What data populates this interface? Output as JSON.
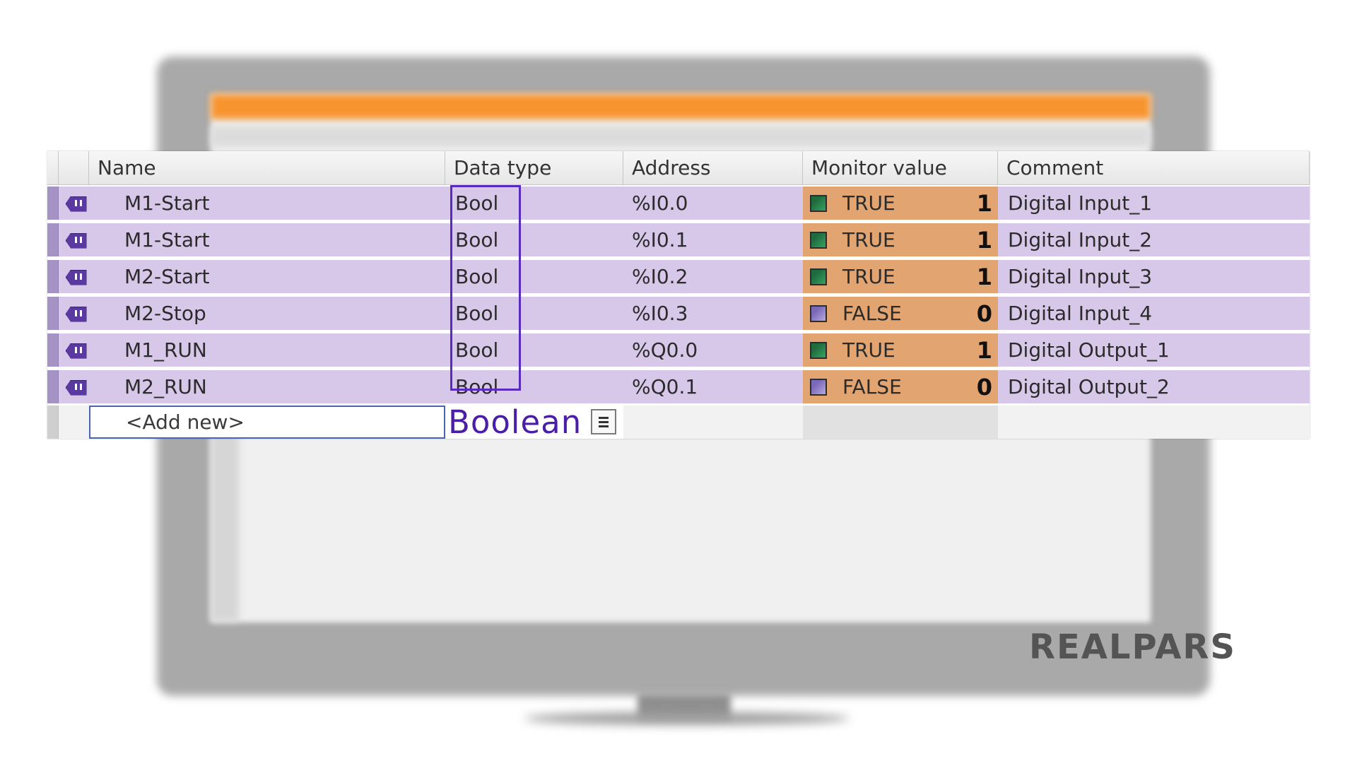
{
  "columns": {
    "name": "Name",
    "data_type": "Data type",
    "address": "Address",
    "monitor_value": "Monitor value",
    "comment": "Comment"
  },
  "rows": [
    {
      "name": "M1-Start",
      "data_type": "Bool",
      "address": "%I0.0",
      "monitor_text": "TRUE",
      "bit": "1",
      "state": "on",
      "comment": "Digital Input_1"
    },
    {
      "name": "M1-Start",
      "data_type": "Bool",
      "address": "%I0.1",
      "monitor_text": "TRUE",
      "bit": "1",
      "state": "on",
      "comment": "Digital Input_2"
    },
    {
      "name": "M2-Start",
      "data_type": "Bool",
      "address": "%I0.2",
      "monitor_text": "TRUE",
      "bit": "1",
      "state": "on",
      "comment": "Digital Input_3"
    },
    {
      "name": "M2-Stop",
      "data_type": "Bool",
      "address": "%I0.3",
      "monitor_text": "FALSE",
      "bit": "0",
      "state": "off",
      "comment": "Digital Input_4"
    },
    {
      "name": "M1_RUN",
      "data_type": "Bool",
      "address": "%Q0.0",
      "monitor_text": "TRUE",
      "bit": "1",
      "state": "on",
      "comment": "Digital Output_1"
    },
    {
      "name": "M2_RUN",
      "data_type": "Bool",
      "address": "%Q0.1",
      "monitor_text": "FALSE",
      "bit": "0",
      "state": "off",
      "comment": "Digital Output_2"
    }
  ],
  "add_row": {
    "name": "<Add new>",
    "data_type_callout": "Boolean"
  },
  "icons": {
    "tag": "input-tag-icon",
    "list": "list-icon",
    "led_on": "status-true-icon",
    "led_off": "status-false-icon"
  },
  "colors": {
    "row_highlight": "#d7c8ea",
    "monitor_background": "#e2a572",
    "callout": "#4a1ea8",
    "led_on": "#1f6b3e",
    "led_off": "#7b68b8"
  },
  "logo": "REALPARS"
}
